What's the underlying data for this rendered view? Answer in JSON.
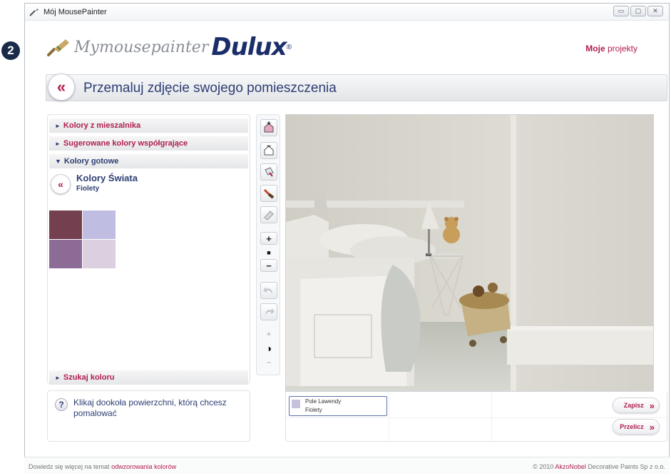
{
  "window": {
    "title": "Mój MousePainter",
    "buttons": [
      "minimize",
      "maximize",
      "close"
    ]
  },
  "step_badge": "2",
  "header": {
    "logo": {
      "my": "My",
      "mouse": "mouse",
      "painter": "painter",
      "brand": "Dulux",
      "reg": "®"
    },
    "projects_link": {
      "bold": "Moje",
      "rest": " projekty"
    }
  },
  "banner": {
    "back_label": "«",
    "title": "Przemaluj zdjęcie swojego pomieszczenia"
  },
  "left_panel": {
    "accordions": [
      {
        "label": "Kolory z mieszalnika",
        "state": "collapsed",
        "marker": "►"
      },
      {
        "label": "Sugerowane kolory współgrające",
        "state": "collapsed",
        "marker": "►"
      },
      {
        "label": "Kolory gotowe",
        "state": "expanded",
        "marker": "▼"
      }
    ],
    "collection": {
      "back_label": "«",
      "title": "Kolory Świata",
      "subtitle": "Fiolety"
    },
    "swatches": [
      {
        "color": "#74404f"
      },
      {
        "color": "#c0bde2"
      },
      {
        "color": "#8d6b97"
      },
      {
        "color": "#dccfe0"
      }
    ],
    "search": {
      "label": "Szukaj koloru",
      "marker": "►"
    }
  },
  "hint": {
    "icon": "question-icon",
    "icon_char": "?",
    "text": "Klikaj dookoła powierzchni, którą chcesz pomalować"
  },
  "toolbar": {
    "tools": [
      {
        "name": "fill-area-icon"
      },
      {
        "name": "unfill-area-icon"
      },
      {
        "name": "paint-bucket-icon"
      },
      {
        "name": "brush-icon"
      },
      {
        "name": "eraser-icon"
      },
      {
        "name": "zoom-in-icon",
        "glyph": "+"
      },
      {
        "name": "brush-size-icon",
        "glyph": "■"
      },
      {
        "name": "zoom-out-icon",
        "glyph": "−"
      },
      {
        "name": "undo-icon"
      },
      {
        "name": "redo-icon"
      },
      {
        "name": "contrast-plus-icon",
        "glyph": "+"
      },
      {
        "name": "contrast-icon",
        "glyph": "◑"
      },
      {
        "name": "contrast-minus-icon",
        "glyph": "−"
      }
    ]
  },
  "bottom_panel": {
    "selected_color": {
      "name": "Pole Lawendy",
      "family": "Fiolety",
      "color": "#c6c1dd"
    },
    "save_label": "Zapisz",
    "recalc_label": "Przelicz",
    "arrow": "»"
  },
  "footer": {
    "left_prefix": "Dowiedz się więcej na temat ",
    "left_link": "odwzorowania kolorów",
    "right_prefix": "© 2010 ",
    "right_link": "AkzoNobel",
    "right_suffix": " Decorative Paints Sp z o.o."
  }
}
